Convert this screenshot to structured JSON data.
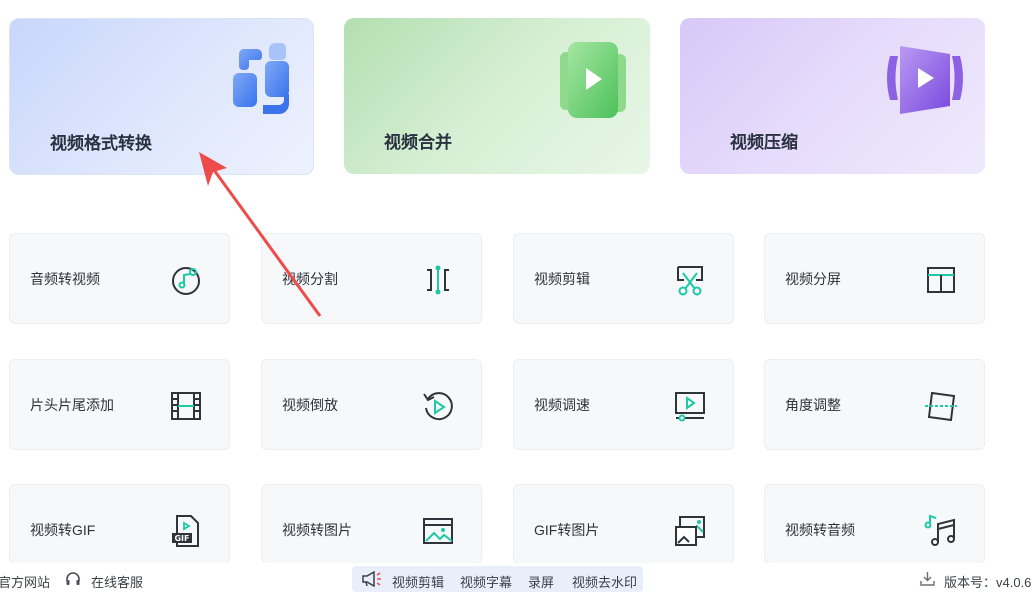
{
  "hero_cards": [
    {
      "label": "视频格式转换",
      "icon": "format-convert-icon"
    },
    {
      "label": "视频合并",
      "icon": "merge-video-icon"
    },
    {
      "label": "视频压缩",
      "icon": "compress-video-icon"
    }
  ],
  "tools": [
    {
      "label": "音频转视频",
      "icon": "audio-to-video-icon"
    },
    {
      "label": "视频分割",
      "icon": "split-icon"
    },
    {
      "label": "视频剪辑",
      "icon": "scissors-icon"
    },
    {
      "label": "视频分屏",
      "icon": "split-screen-icon"
    },
    {
      "label": "片头片尾添加",
      "icon": "film-strip-icon"
    },
    {
      "label": "视频倒放",
      "icon": "reverse-play-icon"
    },
    {
      "label": "视频调速",
      "icon": "speed-icon"
    },
    {
      "label": "角度调整",
      "icon": "rotate-frame-icon"
    },
    {
      "label": "视频转GIF",
      "icon": "gif-file-icon"
    },
    {
      "label": "视频转图片",
      "icon": "image-icon"
    },
    {
      "label": "GIF转图片",
      "icon": "gif-to-image-icon"
    },
    {
      "label": "视频转音频",
      "icon": "music-note-icon"
    }
  ],
  "footer": {
    "official_site": "官方网站",
    "online_service": "在线客服",
    "promo_links": [
      "视频剪辑",
      "视频字幕",
      "录屏",
      "视频去水印"
    ],
    "version": "版本号：v4.0.6"
  },
  "colors": {
    "accent_teal": "#1ec9a7",
    "icon_dark": "#2f343b",
    "annotation_arrow": "#ee4b4b"
  }
}
